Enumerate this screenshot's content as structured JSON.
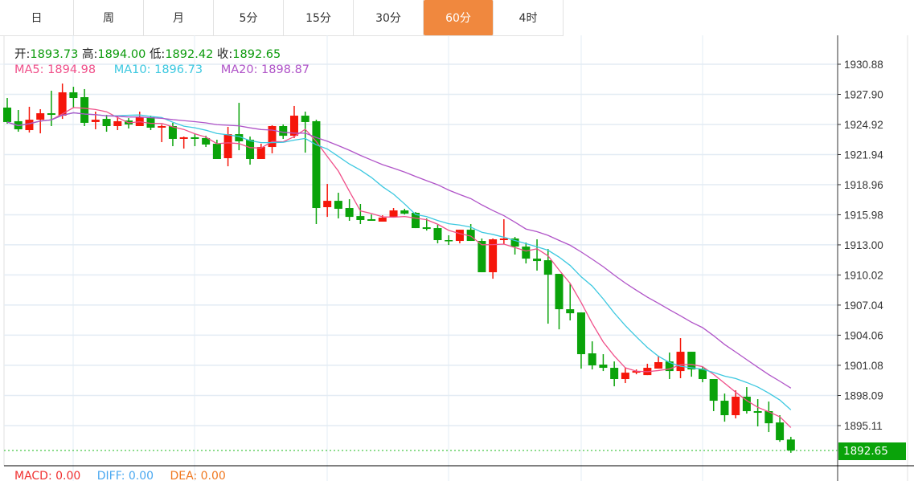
{
  "tabs": [
    "日",
    "周",
    "月",
    "5分",
    "15分",
    "30分",
    "60分",
    "4时"
  ],
  "active_tab": "60分",
  "ohlc_info": {
    "open_label": "开:",
    "open": "1893.73",
    "high_label": "高:",
    "high": "1894.00",
    "low_label": "低:",
    "low": "1892.42",
    "close_label": "收:",
    "close": "1892.65"
  },
  "ma_info": {
    "ma5": "MA5: 1894.98",
    "ma10": "MA10: 1896.73",
    "ma20": "MA20: 1898.87"
  },
  "macd_info": {
    "macd": "MACD: 0.00",
    "diff": "DIFF: 0.00",
    "dea": "DEA: 0.00"
  },
  "current_price": "1892.65",
  "colors": {
    "up": "#f5160a",
    "down": "#0aa30a",
    "ma5": "#f0508a",
    "ma10": "#3cc8e0",
    "ma20": "#b054c8",
    "accent": "#f0883e",
    "macd": "#f03030",
    "diff": "#4aa8f0",
    "dea": "#f07820"
  },
  "chart_data": {
    "type": "candlestick",
    "title": "",
    "ylim": [
      1892.0,
      1932.0
    ],
    "y_ticks": [
      "1930.88",
      "1927.90",
      "1924.92",
      "1921.94",
      "1918.96",
      "1915.98",
      "1913.00",
      "1910.02",
      "1907.04",
      "1904.06",
      "1901.08",
      "1898.09",
      "1895.11"
    ],
    "grid": true,
    "candles": [
      [
        1926.59,
        1927.54,
        1925.0,
        1925.16
      ],
      [
        1925.24,
        1926.35,
        1924.2,
        1924.44
      ],
      [
        1924.36,
        1926.67,
        1924.12,
        1925.39
      ],
      [
        1925.39,
        1926.43,
        1924.04,
        1926.03
      ],
      [
        1926.03,
        1928.26,
        1924.76,
        1925.87
      ],
      [
        1925.79,
        1928.97,
        1925.47,
        1928.1
      ],
      [
        1928.1,
        1928.65,
        1926.59,
        1927.54
      ],
      [
        1927.62,
        1928.42,
        1924.76,
        1925.08
      ],
      [
        1925.16,
        1926.19,
        1924.44,
        1925.39
      ],
      [
        1925.47,
        1925.87,
        1924.2,
        1924.76
      ],
      [
        1924.76,
        1925.71,
        1924.36,
        1925.24
      ],
      [
        1925.31,
        1925.55,
        1924.52,
        1924.92
      ],
      [
        1924.76,
        1926.19,
        1924.76,
        1925.63
      ],
      [
        1925.63,
        1925.79,
        1924.36,
        1924.6
      ],
      [
        1924.6,
        1924.92,
        1923.17,
        1924.76
      ],
      [
        1924.76,
        1925.08,
        1922.77,
        1923.49
      ],
      [
        1923.49,
        1923.72,
        1922.53,
        1923.65
      ],
      [
        1923.65,
        1924.04,
        1922.77,
        1923.49
      ],
      [
        1923.57,
        1923.8,
        1922.69,
        1922.93
      ],
      [
        1923.01,
        1923.41,
        1921.5,
        1921.5
      ],
      [
        1921.58,
        1924.68,
        1920.78,
        1923.96
      ],
      [
        1923.96,
        1927.06,
        1922.37,
        1923.25
      ],
      [
        1923.41,
        1923.72,
        1920.94,
        1921.5
      ],
      [
        1921.5,
        1923.01,
        1921.5,
        1922.69
      ],
      [
        1922.69,
        1924.84,
        1922.06,
        1924.76
      ],
      [
        1924.76,
        1924.92,
        1923.49,
        1923.8
      ],
      [
        1923.8,
        1926.75,
        1923.57,
        1925.79
      ],
      [
        1925.79,
        1926.19,
        1922.13,
        1925.16
      ],
      [
        1925.24,
        1925.39,
        1915.06,
        1916.65
      ],
      [
        1916.73,
        1919.03,
        1915.77,
        1917.36
      ],
      [
        1917.36,
        1918.16,
        1915.62,
        1916.57
      ],
      [
        1916.65,
        1917.52,
        1915.38,
        1915.77
      ],
      [
        1915.85,
        1917.05,
        1915.06,
        1915.46
      ],
      [
        1915.54,
        1916.01,
        1915.38,
        1915.38
      ],
      [
        1915.3,
        1915.93,
        1915.3,
        1915.7
      ],
      [
        1915.77,
        1916.65,
        1915.77,
        1916.41
      ],
      [
        1916.41,
        1916.57,
        1916.01,
        1916.09
      ],
      [
        1916.17,
        1916.25,
        1914.66,
        1914.66
      ],
      [
        1914.74,
        1915.62,
        1914.42,
        1914.58
      ],
      [
        1914.66,
        1914.98,
        1913.15,
        1913.47
      ],
      [
        1913.47,
        1913.95,
        1912.99,
        1913.39
      ],
      [
        1913.39,
        1914.5,
        1913.15,
        1914.5
      ],
      [
        1914.5,
        1915.06,
        1913.39,
        1913.39
      ],
      [
        1913.39,
        1913.63,
        1910.29,
        1910.29
      ],
      [
        1910.29,
        1913.63,
        1909.65,
        1913.55
      ],
      [
        1913.47,
        1915.54,
        1913.07,
        1913.63
      ],
      [
        1913.63,
        1913.79,
        1912.04,
        1912.83
      ],
      [
        1912.83,
        1913.23,
        1911.16,
        1911.64
      ],
      [
        1911.64,
        1913.55,
        1910.45,
        1911.4
      ],
      [
        1911.48,
        1912.59,
        1905.2,
        1910.05
      ],
      [
        1910.13,
        1910.13,
        1904.64,
        1906.63
      ],
      [
        1906.63,
        1909.18,
        1905.52,
        1906.23
      ],
      [
        1906.31,
        1906.31,
        1900.75,
        1902.18
      ],
      [
        1902.26,
        1903.45,
        1900.67,
        1901.07
      ],
      [
        1901.15,
        1902.18,
        1900.51,
        1900.83
      ],
      [
        1900.83,
        1901.46,
        1899.0,
        1899.72
      ],
      [
        1899.72,
        1900.83,
        1899.32,
        1900.35
      ],
      [
        1900.35,
        1900.67,
        1900.19,
        1900.51
      ],
      [
        1900.11,
        1901.23,
        1900.11,
        1900.83
      ],
      [
        1900.75,
        1902.02,
        1900.75,
        1901.39
      ],
      [
        1901.46,
        1902.34,
        1899.72,
        1900.51
      ],
      [
        1900.51,
        1903.77,
        1899.8,
        1902.42
      ],
      [
        1902.42,
        1902.42,
        1899.95,
        1900.67
      ],
      [
        1900.75,
        1900.99,
        1899.4,
        1899.72
      ],
      [
        1899.72,
        1899.72,
        1896.54,
        1897.57
      ],
      [
        1897.57,
        1898.28,
        1895.5,
        1896.14
      ],
      [
        1896.14,
        1898.6,
        1895.82,
        1897.97
      ],
      [
        1897.97,
        1898.92,
        1896.3,
        1896.54
      ],
      [
        1896.54,
        1897.73,
        1895.03,
        1896.38
      ],
      [
        1896.54,
        1897.49,
        1894.47,
        1895.34
      ],
      [
        1895.42,
        1896.14,
        1893.51,
        1893.67
      ],
      [
        1893.73,
        1894.0,
        1892.42,
        1892.65
      ]
    ],
    "candle_format": [
      "open",
      "high",
      "low",
      "close"
    ],
    "moving_averages": [
      5,
      10,
      20
    ]
  }
}
